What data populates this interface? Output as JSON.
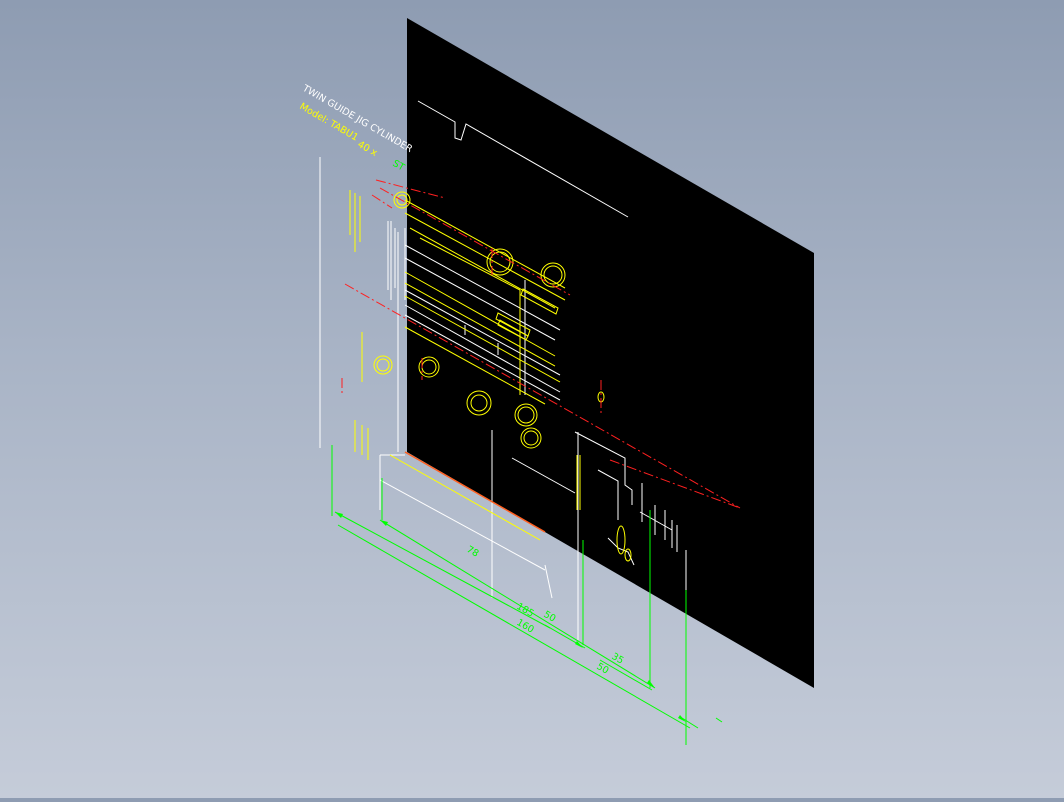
{
  "drawing": {
    "title": "TWIN GUIDE JIG CYLINDER",
    "model_prefix": "Model: TABU1",
    "model_bore": "40 x",
    "model_stroke": "ST",
    "label_top": "",
    "label_small": ""
  },
  "dimensions": {
    "d78": "78",
    "d185": "185",
    "d50a": "50",
    "d35": "35",
    "d50b": "50",
    "d160": "160"
  },
  "colors": {
    "background_top": "#8e9cb2",
    "background_bottom": "#c5ccd9",
    "sheet": "#000000",
    "line_white": "#ffffff",
    "line_yellow": "#ffff00",
    "line_red": "#ff2020",
    "line_green": "#00ff00"
  }
}
